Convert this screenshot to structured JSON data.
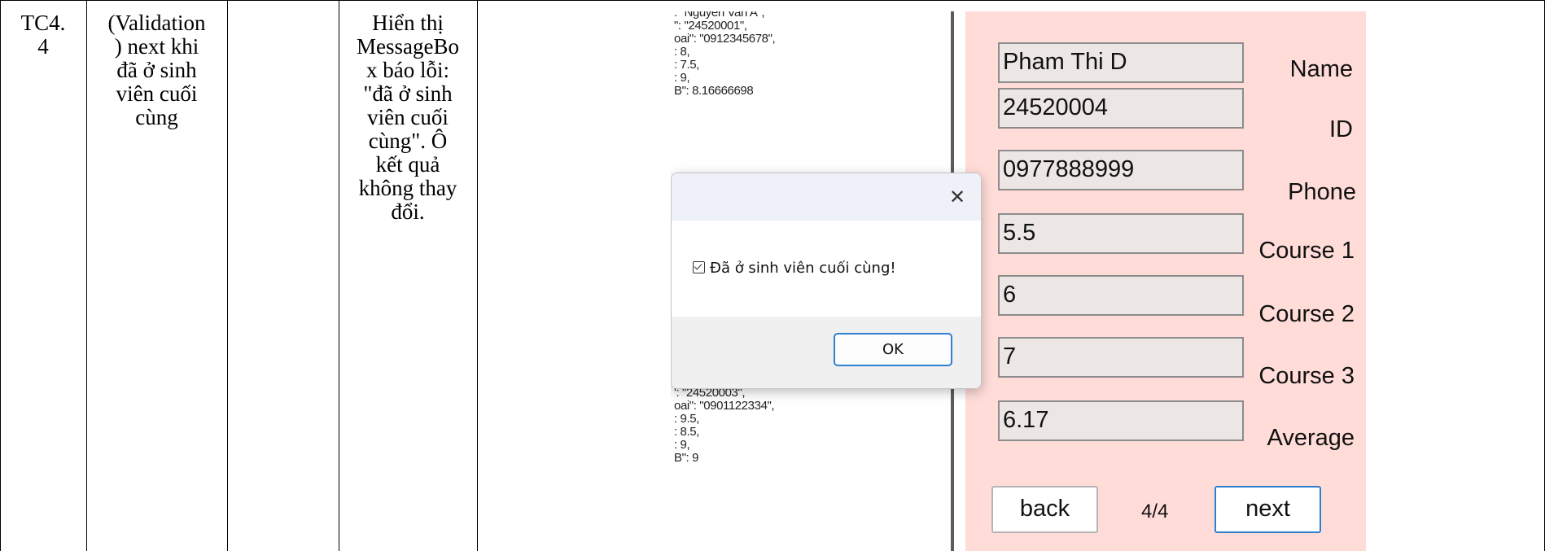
{
  "table_row": {
    "test_id": "TC4.\n4",
    "description": "(Validation\n) next khi\nđã ở sinh\nviên cuối\ncùng",
    "input": "",
    "expected": "Hiển thị\nMessageBo\nx báo lỗi:\n\"đã ở sinh\nviên cuối\ncùng\". Ô\nkết quả\nkhông thay\nđổi.",
    "actual": ""
  },
  "screenshot": {
    "json_text_top": ": \"Nguyen Van A\",\n\": \"24520001\",\noai\": \"0912345678\",\n: 8,\n: 7.5,\n: 9,\nB\": 8.16666698",
    "json_text_bottom": "\": \"Le Van C\",\n': \"24520003\",\noai\": \"0901122334\",\n: 9.5,\n: 8.5,\n: 9,\nB\": 9",
    "form": {
      "name_value": "Pham Thi D",
      "name_label": "Name",
      "id_value": "24520004",
      "id_label": "ID",
      "phone_value": "0977888999",
      "phone_label": "Phone",
      "course1_value": "5.5",
      "course1_label": "Course 1",
      "course2_value": "6",
      "course2_label": "Course 2",
      "course3_value": "7",
      "course3_label": "Course 3",
      "average_value": "6.17",
      "average_label": "Average",
      "back_label": "back",
      "counter": "4/4",
      "next_label": "next"
    },
    "message_box": {
      "close_icon": "close-icon",
      "message": "Đã ở sinh viên cuối cùng!",
      "ok_label": "OK"
    }
  },
  "colors": {
    "form_background": "#ffdcd8",
    "ok_border": "#2f7fd1"
  }
}
